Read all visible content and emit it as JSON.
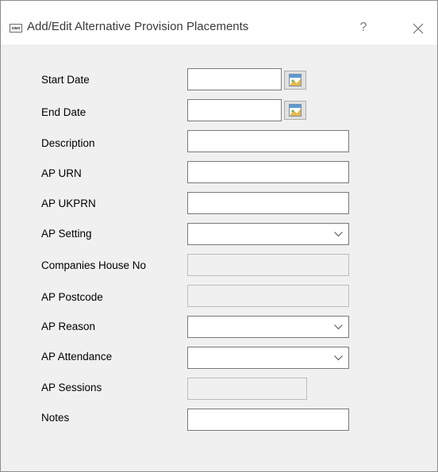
{
  "window": {
    "title": "Add/Edit Alternative Provision Placements",
    "app_icon_text": "SIMS",
    "help_label": "?"
  },
  "form": {
    "start_date": {
      "label": "Start Date",
      "value": ""
    },
    "end_date": {
      "label": "End Date",
      "value": ""
    },
    "description": {
      "label": "Description",
      "value": ""
    },
    "ap_urn": {
      "label": "AP URN",
      "value": ""
    },
    "ap_ukprn": {
      "label": "AP UKPRN",
      "value": ""
    },
    "ap_setting": {
      "label": "AP Setting",
      "selected": ""
    },
    "companies_house_no": {
      "label": "Companies House No",
      "value": ""
    },
    "ap_postcode": {
      "label": "AP Postcode",
      "value": ""
    },
    "ap_reason": {
      "label": "AP Reason",
      "selected": ""
    },
    "ap_attendance": {
      "label": "AP Attendance",
      "selected": ""
    },
    "ap_sessions": {
      "label": "AP Sessions",
      "value": ""
    },
    "notes": {
      "label": "Notes",
      "value": ""
    }
  },
  "icons": {
    "app": "sims-app-icon",
    "help": "help-icon",
    "close": "close-icon",
    "calendar": "calendar-icon",
    "dropdown": "chevron-down-icon"
  }
}
